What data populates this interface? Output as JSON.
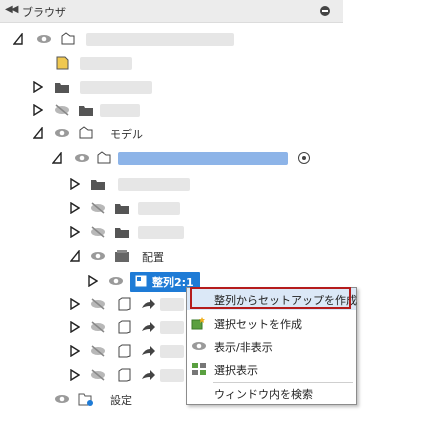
{
  "panel": {
    "title": "ブラウザ"
  },
  "tree": {
    "model_label": "モデル",
    "layout_label": "配置",
    "selected_label": "整列2:1",
    "settings_label": "設定"
  },
  "context_menu": {
    "items": [
      {
        "label": "整列からセットアップを作成",
        "icon": "",
        "highlighted": true
      },
      {
        "label": "選択セットを作成",
        "icon": "selection-set-icon"
      },
      {
        "label": "表示/非表示",
        "icon": "eye-icon"
      },
      {
        "label": "選択表示",
        "icon": "grid-select-icon"
      },
      {
        "label": "ウィンドウ内を検索",
        "icon": ""
      }
    ]
  },
  "colors": {
    "selection": "#1e7bd6",
    "highlight_border": "#b51c1c",
    "menu_hover": "#dbe8f7"
  }
}
